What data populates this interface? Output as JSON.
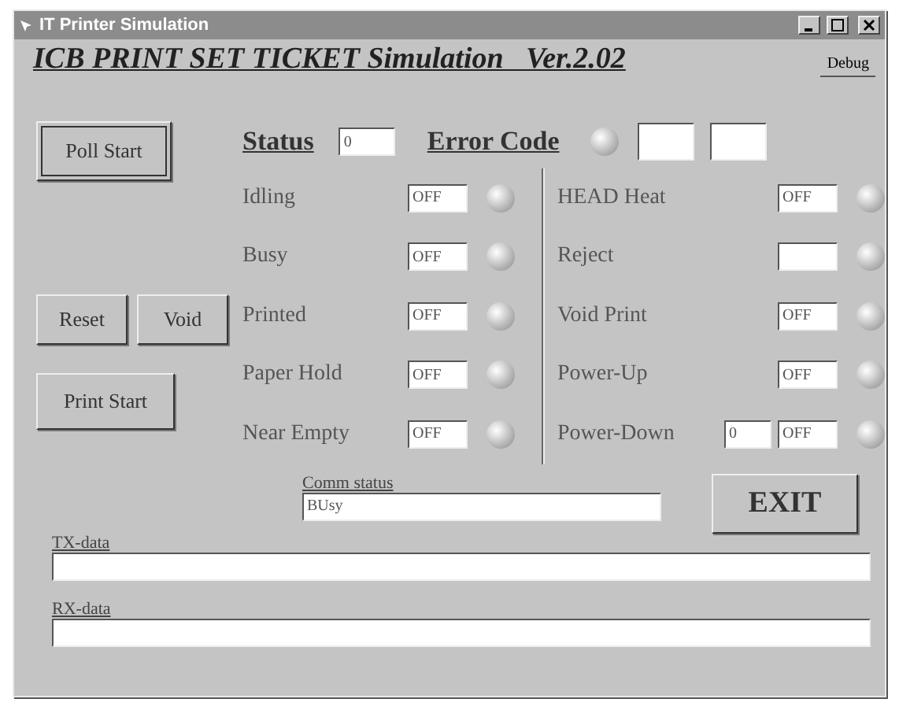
{
  "window": {
    "title": "IT Printer Simulation"
  },
  "header": {
    "title": "ICB PRINT SET TICKET Simulation   Ver.2.02",
    "debug_button": "Debug"
  },
  "left_buttons": {
    "poll": "Poll Start",
    "reset": "Reset",
    "void": "Void",
    "print": "Print Start"
  },
  "status": {
    "label": "Status",
    "value": "0"
  },
  "error_code": {
    "label": "Error Code",
    "lamp_lit": false
  },
  "left_signals": [
    {
      "label": "Idling",
      "value": "OFF",
      "lit": false
    },
    {
      "label": "Busy",
      "value": "OFF",
      "lit": false
    },
    {
      "label": "Printed",
      "value": "OFF",
      "lit": false
    },
    {
      "label": "Paper Hold",
      "value": "OFF",
      "lit": false
    },
    {
      "label": "Near Empty",
      "value": "OFF",
      "lit": false
    }
  ],
  "right_signals": [
    {
      "label": "HEAD Heat",
      "value": "OFF",
      "lit": false
    },
    {
      "label": "Reject",
      "lit": false
    },
    {
      "label": "Void Print",
      "value": "OFF",
      "lit": false
    },
    {
      "label": "Power-Up",
      "value": "OFF",
      "lit": false
    },
    {
      "label": "Power-Down",
      "count": "0",
      "value": "OFF",
      "lit": false
    }
  ],
  "comm_status": {
    "label": "Comm status",
    "value": "BUsy"
  },
  "exit_button": "EXIT",
  "tx": {
    "label": "TX-data"
  },
  "rx": {
    "label": "RX-data"
  }
}
